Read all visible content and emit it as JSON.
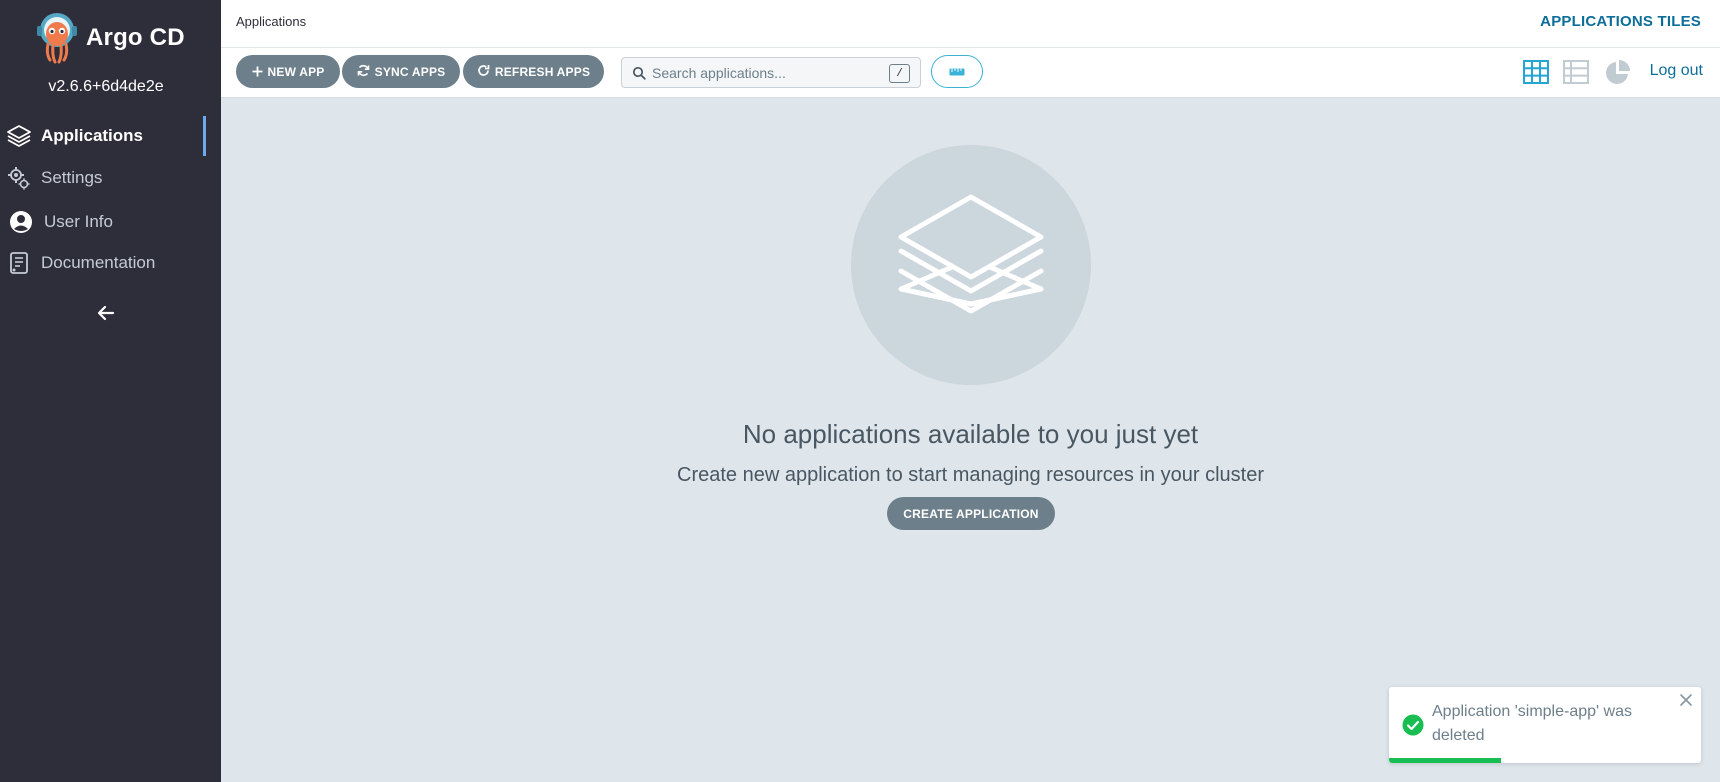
{
  "sidebar": {
    "brand": "Argo CD",
    "version": "v2.6.6+6d4de2e",
    "items": [
      {
        "label": "Applications",
        "icon": "layers-icon",
        "active": true
      },
      {
        "label": "Settings",
        "icon": "gears-icon",
        "active": false
      },
      {
        "label": "User Info",
        "icon": "user-circle-icon",
        "active": false
      },
      {
        "label": "Documentation",
        "icon": "book-icon",
        "active": false
      }
    ],
    "collapse_icon": "arrow-left-icon"
  },
  "topbar": {
    "breadcrumb": "Applications",
    "title": "APPLICATIONS TILES"
  },
  "toolbar": {
    "new_app": "NEW APP",
    "sync_apps": "SYNC APPS",
    "refresh_apps": "REFRESH APPS",
    "search_placeholder": "Search applications...",
    "search_shortcut": "/",
    "filter_icon": "ruler-icon",
    "views": [
      "tiles-view-icon",
      "list-view-icon",
      "summary-pie-icon"
    ],
    "logout": "Log out"
  },
  "empty_state": {
    "icon": "layers-icon",
    "title": "No applications available to you just yet",
    "subtitle": "Create new application to start managing resources in your cluster",
    "button": "CREATE APPLICATION"
  },
  "toast": {
    "message": "Application 'simple-app' was deleted",
    "progress": 0.36
  },
  "colors": {
    "sidebar_bg": "#2e2e3a",
    "content_bg": "#dee6eb",
    "button_bg": "#6d7f8b",
    "accent": "#0d6e9a",
    "teal": "#3bb3d6",
    "success": "#18be52"
  }
}
